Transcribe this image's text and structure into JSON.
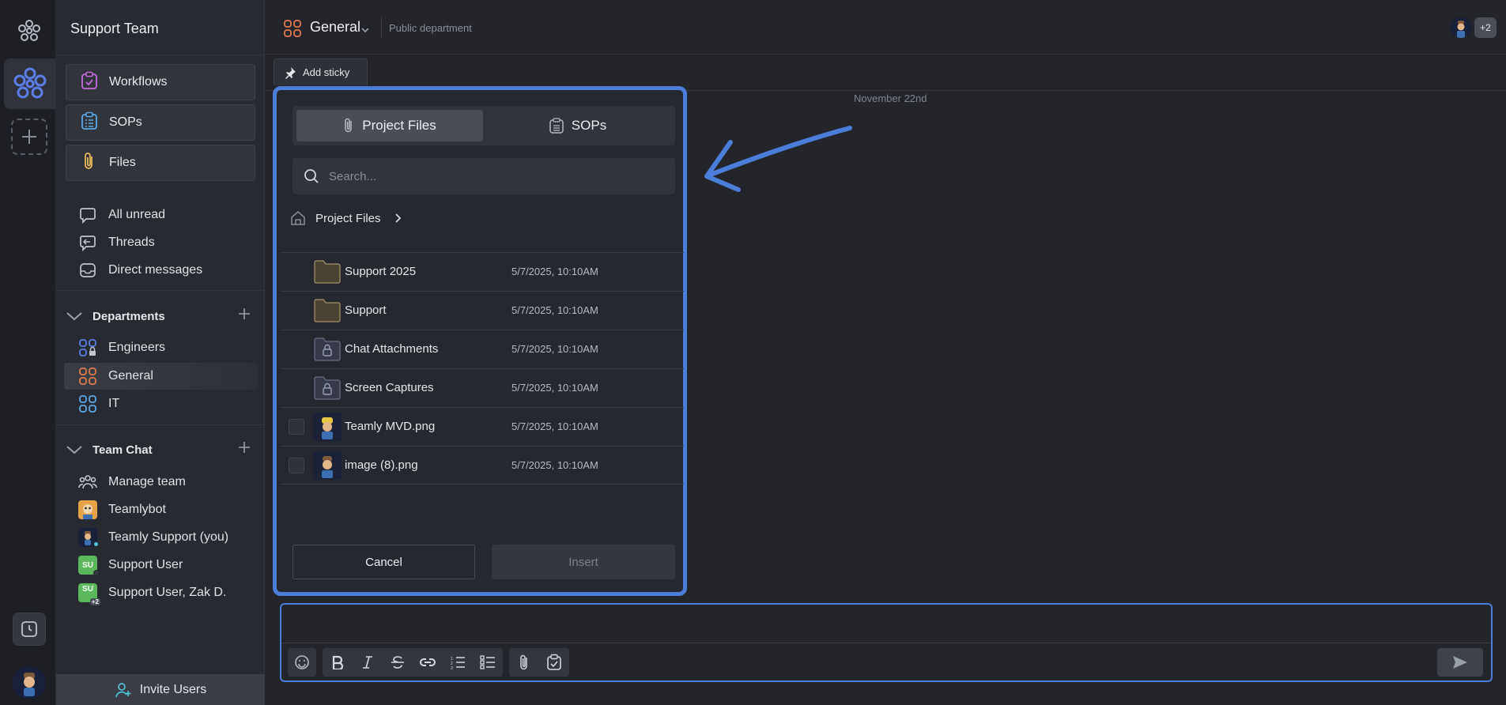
{
  "workspace": {
    "name": "Support Team"
  },
  "sidebar": {
    "cards": [
      {
        "label": "Workflows",
        "icon": "clipboard-check-icon"
      },
      {
        "label": "SOPs",
        "icon": "list-clipboard-icon"
      },
      {
        "label": "Files",
        "icon": "paperclip-icon"
      }
    ],
    "nav": [
      {
        "label": "All unread",
        "icon": "chat-bubble-icon"
      },
      {
        "label": "Threads",
        "icon": "threads-icon"
      },
      {
        "label": "Direct messages",
        "icon": "inbox-icon"
      }
    ],
    "departments_title": "Departments",
    "departments": [
      {
        "label": "Engineers",
        "color": "#5b7ee8"
      },
      {
        "label": "General",
        "color": "#e07a4b"
      },
      {
        "label": "IT",
        "color": "#5aa8e8"
      }
    ],
    "teamchat_title": "Team Chat",
    "teamchat": [
      {
        "label": "Manage team"
      },
      {
        "label": "Teamlybot"
      },
      {
        "label": "Teamly Support (you)"
      },
      {
        "label": "Support User",
        "initials": "SU"
      },
      {
        "label": "Support User, Zak D.",
        "initials": "SU",
        "badge": "+2"
      }
    ],
    "invite_label": "Invite Users"
  },
  "channel": {
    "title": "General",
    "subtitle": "Public department",
    "extra_members": "+2",
    "add_sticky": "Add sticky",
    "date_separator": "November 22nd"
  },
  "picker": {
    "tabs": [
      {
        "label": "Project Files",
        "active": true
      },
      {
        "label": "SOPs",
        "active": false
      }
    ],
    "search_placeholder": "Search...",
    "breadcrumb": "Project Files",
    "files": [
      {
        "name": "Support 2025",
        "date": "5/7/2025, 10:10AM",
        "type": "folder"
      },
      {
        "name": "Support",
        "date": "5/7/2025, 10:10AM",
        "type": "folder"
      },
      {
        "name": "Chat Attachments",
        "date": "5/7/2025, 10:10AM",
        "type": "locked-folder"
      },
      {
        "name": "Screen Captures",
        "date": "5/7/2025, 10:10AM",
        "type": "locked-folder"
      },
      {
        "name": "Teamly MVD.png",
        "date": "5/7/2025, 10:10AM",
        "type": "image"
      },
      {
        "name": "image (8).png",
        "date": "5/7/2025, 10:10AM",
        "type": "image"
      }
    ],
    "cancel_label": "Cancel",
    "insert_label": "Insert"
  },
  "colors": {
    "accent": "#4a7ed9",
    "teamchat_green": "#5cb85c"
  }
}
